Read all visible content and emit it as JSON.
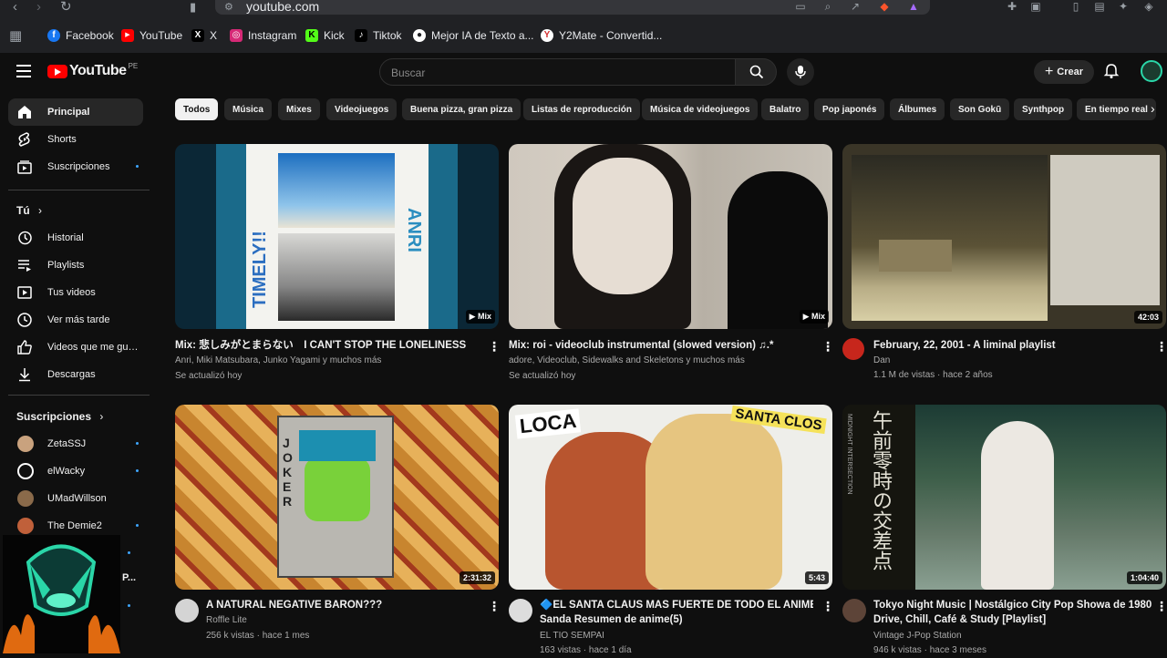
{
  "browser": {
    "url": "youtube.com",
    "bookmarks": [
      {
        "label": "Facebook",
        "color": "#1877f2",
        "glyph": "f"
      },
      {
        "label": "YouTube",
        "color": "#ff0000",
        "glyph": "▶"
      },
      {
        "label": "X",
        "color": "#000000",
        "glyph": "X"
      },
      {
        "label": "Instagram",
        "color": "#d62976",
        "glyph": "◎"
      },
      {
        "label": "Kick",
        "color": "#53fc18",
        "glyph": "K"
      },
      {
        "label": "Tiktok",
        "color": "#000000",
        "glyph": "♪"
      },
      {
        "label": "Mejor IA de Texto a...",
        "color": "#ffffff",
        "glyph": "●"
      },
      {
        "label": "Y2Mate - Convertid...",
        "color": "#ffffff",
        "glyph": "Y"
      }
    ]
  },
  "header": {
    "logo_text": "YouTube",
    "region": "PE",
    "search_placeholder": "Buscar",
    "create_label": "Crear"
  },
  "sidebar": {
    "main": [
      {
        "label": "Principal",
        "icon": "home-icon"
      },
      {
        "label": "Shorts",
        "icon": "shorts-icon"
      },
      {
        "label": "Suscripciones",
        "icon": "subscriptions-icon"
      }
    ],
    "you_heading": "Tú",
    "you": [
      {
        "label": "Historial",
        "icon": "history-icon"
      },
      {
        "label": "Playlists",
        "icon": "playlists-icon"
      },
      {
        "label": "Tus videos",
        "icon": "your-videos-icon"
      },
      {
        "label": "Ver más tarde",
        "icon": "watch-later-icon"
      },
      {
        "label": "Videos que me gus...",
        "icon": "like-icon"
      },
      {
        "label": "Descargas",
        "icon": "download-icon"
      }
    ],
    "subs_heading": "Suscripciones",
    "subs": [
      {
        "label": "ZetaSSJ",
        "color": "#c9a27e"
      },
      {
        "label": "elWacky",
        "color": "#ffffff"
      },
      {
        "label": "UMadWillson",
        "color": "#8a6a4a"
      },
      {
        "label": "The Demie2",
        "color": "#c0603a"
      }
    ],
    "partial_label": "P..."
  },
  "chips": [
    "Todos",
    "Música",
    "Mixes",
    "Videojuegos",
    "Buena pizza, gran pizza",
    "Listas de reproducción",
    "Música de videojuegos",
    "Balatro",
    "Pop japonés",
    "Álbumes",
    "Son Gokū",
    "Synthpop",
    "En tiempo real"
  ],
  "videos": [
    {
      "title": "Mix: 悲しみがとまらない　I CAN'T STOP THE LONELINESS",
      "line1": "Anri, Miki Matsubara, Junko Yagami y muchos más",
      "line2": "Se actualizó hoy",
      "badge": "▶ Mix",
      "thumb_title1": "TIMELY!!",
      "thumb_title2": "ANRI"
    },
    {
      "title": "Mix: roi - videoclub instrumental (slowed version) ♫.*",
      "line1": "adore, Videoclub, Sidewalks and Skeletons y muchos más",
      "line2": "Se actualizó hoy",
      "badge": "▶ Mix"
    },
    {
      "title": "February, 22, 2001 - A liminal playlist",
      "line1": "Dan",
      "line2": "1.1 M de vistas · hace 2 años",
      "badge": "42:03"
    },
    {
      "title": "A NATURAL NEGATIVE BARON???",
      "line1": "Roffle Lite",
      "line2": "256 k vistas · hace 1 mes",
      "badge": "2:31:32",
      "thumb_word": "JOKER"
    },
    {
      "title": "🔷EL SANTA CLAUS MAS FUERTE DE TODO EL ANIME",
      "title2": "Sanda Resumen de anime(5)",
      "line1": "EL TIO SEMPAI",
      "line2": "163 vistas · hace 1 día",
      "badge": "5:43",
      "thumb_left": "LOCA",
      "thumb_right": "SANTA CLOS"
    },
    {
      "title": "Tokyo Night Music | Nostálgico City Pop Showa de 1980 |",
      "title2": "Drive, Chill, Café & Study [Playlist]",
      "line1": "Vintage J-Pop Station",
      "line2": "946 k vistas · hace 3 meses",
      "badge": "1:04:40",
      "thumb_jp": "午前零時の交差点",
      "thumb_en": "MIDNIGHT INTERSECTION"
    }
  ],
  "colors": {
    "accent": "#ff0000",
    "dot": "#3ea6ff",
    "bg": "#0f0f0f"
  }
}
